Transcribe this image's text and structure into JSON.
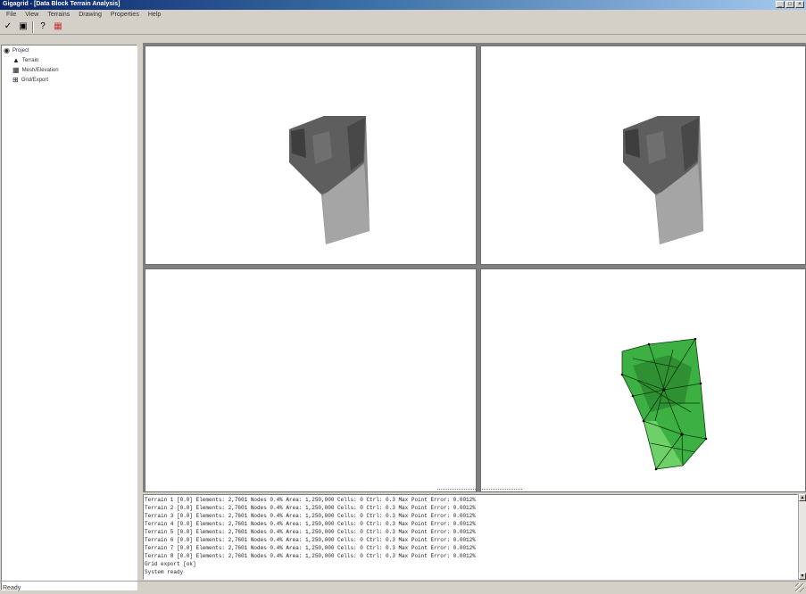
{
  "window": {
    "title": "Gigagrid - [Data Block Terrain Analysis]",
    "controls": [
      "_",
      "□",
      "×"
    ]
  },
  "menu": {
    "items": [
      "File",
      "View",
      "Terrains",
      "Drawing",
      "Properties",
      "Help"
    ]
  },
  "toolbar": {
    "buttons": [
      {
        "name": "open-icon",
        "glyph": "✓"
      },
      {
        "name": "save-icon",
        "glyph": "▣"
      },
      {
        "name": "help-icon",
        "glyph": "?"
      },
      {
        "name": "grid-icon",
        "glyph": "▦",
        "color": "#cc3333"
      }
    ]
  },
  "tree": {
    "root": "Project",
    "children": [
      "Terrain",
      "Mesh/Elevation",
      "Grid/Export"
    ]
  },
  "viewports": {
    "top_left": "terrain-grey-view",
    "top_right": "terrain-grey-view",
    "bottom_left": "empty-view",
    "bottom_right": "terrain-mesh-view",
    "colors": {
      "terrain_dark": "#555555",
      "terrain_light": "#9a9a9a",
      "mesh_green": "#3cb043",
      "mesh_line": "#0b3d0b"
    }
  },
  "output": {
    "lines": [
      "Terrain 1 [0.0] Elements: 2,7601 Nodes 0.4% Area: 1,250,000 Cells: 0 Ctrl: 0.3 Max Point Error: 0.0012%",
      "Terrain 2 [0.0] Elements: 2,7601 Nodes 0.4% Area: 1,250,000 Cells: 0 Ctrl: 0.3 Max Point Error: 0.0012%",
      "Terrain 3 [0.0] Elements: 2,7601 Nodes 0.4% Area: 1,250,000 Cells: 0 Ctrl: 0.3 Max Point Error: 0.0012%",
      "Terrain 4 [0.0] Elements: 2,7601 Nodes 0.4% Area: 1,250,000 Cells: 0 Ctrl: 0.3 Max Point Error: 0.0012%",
      "Terrain 5 [0.0] Elements: 2,7601 Nodes 0.4% Area: 1,250,000 Cells: 0 Ctrl: 0.3 Max Point Error: 0.0012%",
      "Terrain 6 [0.0] Elements: 2,7601 Nodes 0.4% Area: 1,250,000 Cells: 0 Ctrl: 0.3 Max Point Error: 0.0012%",
      "Terrain 7 [0.0] Elements: 2,7601 Nodes 0.4% Area: 1,250,000 Cells: 0 Ctrl: 0.3 Max Point Error: 0.0012%",
      "Terrain 8 [0.0] Elements: 2,7601 Nodes 0.4% Area: 1,250,000 Cells: 0 Ctrl: 0.3 Max Point Error: 0.0012%",
      "Grid export [ok]",
      "System ready"
    ]
  },
  "status": {
    "text": "Ready"
  }
}
